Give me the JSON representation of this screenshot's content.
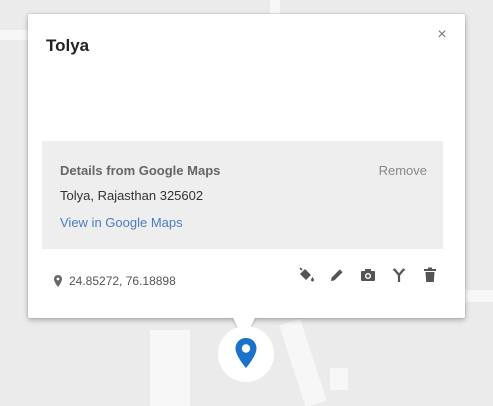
{
  "popup": {
    "title": "Tolya",
    "close_label": "×",
    "details": {
      "heading": "Details from Google Maps",
      "remove_label": "Remove",
      "address": "Tolya, Rajasthan 325602",
      "link_label": "View in Google Maps"
    },
    "coordinates": "24.85272, 76.18898",
    "toolbar": [
      "paint-bucket-icon",
      "pencil-icon",
      "camera-icon",
      "directions-icon",
      "trash-icon"
    ]
  },
  "colors": {
    "accent": "#1a73c9",
    "link": "#4a7cc0",
    "panel": "#eeeeee",
    "map_background": "#ebebeb"
  }
}
